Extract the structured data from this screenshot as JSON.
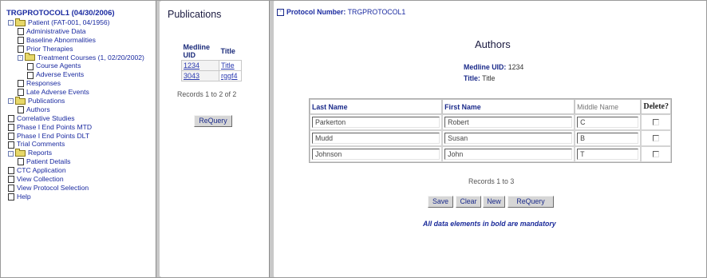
{
  "tree": {
    "title": "TRGPROTOCOL1 (04/30/2006)",
    "nodes": [
      {
        "label": "Patient (FAT-001, 04/1956)",
        "kind": "folder",
        "indent": 0,
        "expander": "-"
      },
      {
        "label": "Administrative Data",
        "kind": "doc",
        "indent": 1
      },
      {
        "label": "Baseline Abnormalities",
        "kind": "doc",
        "indent": 1
      },
      {
        "label": "Prior Therapies",
        "kind": "doc",
        "indent": 1
      },
      {
        "label": "Treatment Courses (1, 02/20/2002)",
        "kind": "folder",
        "indent": 1,
        "expander": "-"
      },
      {
        "label": "Course Agents",
        "kind": "doc",
        "indent": 2
      },
      {
        "label": "Adverse Events",
        "kind": "doc",
        "indent": 2
      },
      {
        "label": "Responses",
        "kind": "doc",
        "indent": 1
      },
      {
        "label": "Late Adverse Events",
        "kind": "doc",
        "indent": 1
      },
      {
        "label": "Publications",
        "kind": "folder",
        "indent": 0,
        "expander": "-"
      },
      {
        "label": "Authors",
        "kind": "doc",
        "indent": 1
      },
      {
        "label": "Correlative Studies",
        "kind": "doc",
        "indent": 0
      },
      {
        "label": "Phase I End Points MTD",
        "kind": "doc",
        "indent": 0
      },
      {
        "label": "Phase I End Points DLT",
        "kind": "doc",
        "indent": 0
      },
      {
        "label": "Trial Comments",
        "kind": "doc",
        "indent": 0
      },
      {
        "label": "Reports",
        "kind": "folder",
        "indent": 0,
        "expander": "-"
      },
      {
        "label": "Patient Details",
        "kind": "doc",
        "indent": 1
      },
      {
        "label": "CTC Application",
        "kind": "doc",
        "indent": 0
      },
      {
        "label": "View Collection",
        "kind": "doc",
        "indent": 0
      },
      {
        "label": "View Protocol Selection",
        "kind": "doc",
        "indent": 0
      },
      {
        "label": "Help",
        "kind": "doc",
        "indent": 0
      }
    ]
  },
  "publications": {
    "title": "Publications",
    "headers": [
      "Medline UID",
      "Title"
    ],
    "rows": [
      {
        "uid": "1234",
        "title": "Title"
      },
      {
        "uid": "3043",
        "title": "rggf4"
      }
    ],
    "records": "Records 1 to 2 of 2",
    "requery_label": "ReQuery"
  },
  "detail": {
    "protocol_toggle": "-",
    "protocol_label": "Protocol Number:",
    "protocol_value": "TRGPROTOCOL1",
    "heading": "Authors",
    "uid_label": "Medline UID:",
    "uid_value": "1234",
    "title_label": "Title:",
    "title_value": "Title",
    "headers": [
      "Last Name",
      "First Name",
      "Middle Name",
      "Delete?"
    ],
    "rows": [
      {
        "last": "Parkerton",
        "first": "Robert",
        "middle": "C"
      },
      {
        "last": "Mudd",
        "first": "Susan",
        "middle": "B"
      },
      {
        "last": "Johnson",
        "first": "John",
        "middle": "T"
      }
    ],
    "records": "Records 1 to 3",
    "buttons": {
      "save": "Save",
      "clear": "Clear",
      "new": "New",
      "requery": "ReQuery"
    },
    "mandatory_note": "All data elements in bold are mandatory"
  },
  "colors": {
    "link": "#1a2aa0",
    "separator": "#c8c8c8",
    "button": "#d6d6d6"
  }
}
